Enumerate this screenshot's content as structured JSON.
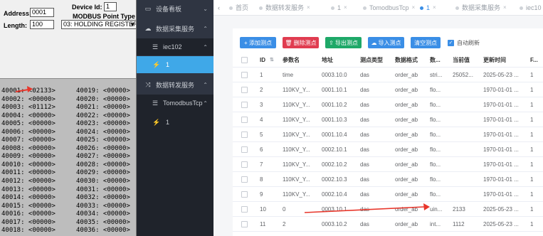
{
  "modbus": {
    "address_label": "Address:",
    "address_value": "0001",
    "length_label": "Length:",
    "length_value": "100",
    "device_id_label": "Device Id:",
    "device_id_value": "1",
    "point_type_label": "MODBUS Point Type",
    "point_type_value": "03: HOLDING REGISTER",
    "registers_left": [
      "40001: <02133>",
      "40002: <00000>",
      "40003: <01112>",
      "40004: <00000>",
      "40005: <00000>",
      "40006: <00000>",
      "40007: <00000>",
      "40008: <00000>",
      "40009: <00000>",
      "40010: <00000>",
      "40011: <00000>",
      "40012: <00000>",
      "40013: <00000>",
      "40014: <00000>",
      "40015: <00000>",
      "40016: <00000>",
      "40017: <00000>",
      "40018: <00000>"
    ],
    "registers_right": [
      "40019: <00000>",
      "40020: <00000>",
      "40021: <00000>",
      "40022: <00000>",
      "40023: <00000>",
      "40024: <00000>",
      "40025: <00000>",
      "40026: <00000>",
      "40027: <00000>",
      "40028: <00000>",
      "40029: <00000>",
      "40030: <00000>",
      "40031: <00000>",
      "40032: <00000>",
      "40033: <00000>",
      "40034: <00000>",
      "40035: <00000>",
      "40036: <00000>"
    ]
  },
  "sidebar": {
    "dashboard": "设备看板",
    "collect_service": "数据采集服务",
    "collect_channel": "iec102",
    "collect_device": "1",
    "forward_service": "数据转发服务",
    "forward_channel": "TomodbusTcp",
    "forward_device": "1"
  },
  "tabs": {
    "home": "首页",
    "forward_service": "数据转发服务",
    "t1": "1",
    "tomodbus": "TomodbusTcp",
    "t1_active": "1",
    "collect_service": "数据采集服务",
    "iec": "iec10"
  },
  "toolbar": {
    "add": "+ 添加测点",
    "delete": "删除测点",
    "export": "导出测点",
    "import": "导入测点",
    "clear": "清空测点",
    "auto_refresh": "自动刷新"
  },
  "colors": {
    "add": "#3a8ee6",
    "delete": "#e03c50",
    "export": "#1ea868",
    "import": "#3a8ee6",
    "clear": "#3a8ee6",
    "sidebar_bg": "#2f3542",
    "active": "#3fa8e8",
    "arrow": "#e8362b"
  },
  "table": {
    "headers": [
      "ID",
      "参数名",
      "地址",
      "测点类型",
      "数据格式",
      "数...",
      "当前值",
      "更新时间",
      "F..."
    ],
    "rows": [
      [
        "1",
        "time",
        "0003.10.0",
        "das",
        "order_ab",
        "stri...",
        "25052...",
        "2025-05-23 ...",
        "1"
      ],
      [
        "2",
        "110KV_Y...",
        "0001.10.1",
        "das",
        "order_ab",
        "flo...",
        "",
        "1970-01-01 ...",
        "1"
      ],
      [
        "3",
        "110KV_Y...",
        "0001.10.2",
        "das",
        "order_ab",
        "flo...",
        "",
        "1970-01-01 ...",
        "1"
      ],
      [
        "4",
        "110KV_Y...",
        "0001.10.3",
        "das",
        "order_ab",
        "flo...",
        "",
        "1970-01-01 ...",
        "1"
      ],
      [
        "5",
        "110KV_Y...",
        "0001.10.4",
        "das",
        "order_ab",
        "flo...",
        "",
        "1970-01-01 ...",
        "1"
      ],
      [
        "6",
        "110KV_Y...",
        "0002.10.1",
        "das",
        "order_ab",
        "flo...",
        "",
        "1970-01-01 ...",
        "1"
      ],
      [
        "7",
        "110KV_Y...",
        "0002.10.2",
        "das",
        "order_ab",
        "flo...",
        "",
        "1970-01-01 ...",
        "1"
      ],
      [
        "8",
        "110KV_Y...",
        "0002.10.3",
        "das",
        "order_ab",
        "flo...",
        "",
        "1970-01-01 ...",
        "1"
      ],
      [
        "9",
        "110KV_Y...",
        "0002.10.4",
        "das",
        "order_ab",
        "flo...",
        "",
        "1970-01-01 ...",
        "1"
      ],
      [
        "10",
        "0",
        "0003.10.1",
        "das",
        "order_ab",
        "uin...",
        "2133",
        "2025-05-23 ...",
        "1"
      ],
      [
        "11",
        "2",
        "0003.10.2",
        "das",
        "order_ab",
        "int...",
        "1112",
        "2025-05-23 ...",
        "1"
      ]
    ]
  }
}
